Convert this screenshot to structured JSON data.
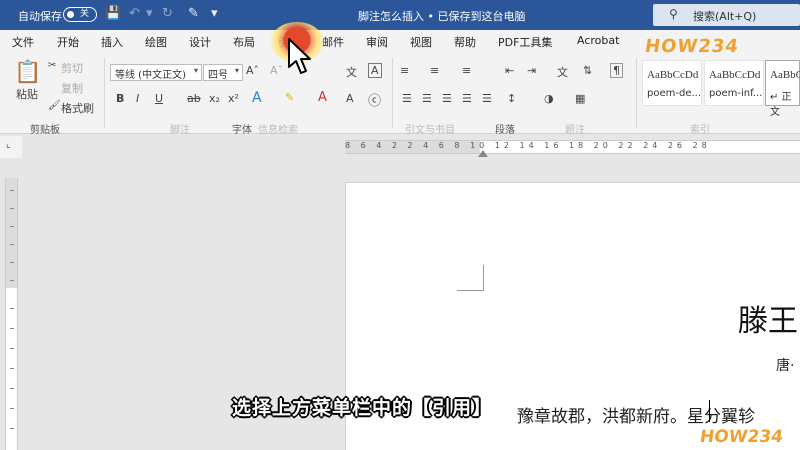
{
  "titlebar": {
    "autosave_label": "自动保存",
    "autosave_state": "关",
    "document_title": "脚注怎么插入 • 已保存到这台电脑",
    "search_placeholder": "搜索(Alt+Q)"
  },
  "tabs": [
    {
      "label": "文件"
    },
    {
      "label": "开始"
    },
    {
      "label": "插入"
    },
    {
      "label": "绘图"
    },
    {
      "label": "设计"
    },
    {
      "label": "布局"
    },
    {
      "label": "引用"
    },
    {
      "label": "邮件"
    },
    {
      "label": "审阅"
    },
    {
      "label": "视图"
    },
    {
      "label": "帮助"
    },
    {
      "label": "PDF工具集"
    },
    {
      "label": "Acrobat"
    }
  ],
  "active_tab": "引用",
  "ribbon": {
    "clipboard": {
      "paste": "粘贴",
      "cut": "剪切",
      "copy": "复制",
      "format_painter": "格式刷",
      "group": "剪贴板"
    },
    "font": {
      "font_name": "等线 (中文正文)",
      "font_size": "四号",
      "group": "字体"
    },
    "paragraph": {
      "group": "段落"
    },
    "styles": [
      {
        "sample": "AaBbCcDd",
        "name": "poem-de..."
      },
      {
        "sample": "AaBbCcDd",
        "name": "poem-inf..."
      },
      {
        "sample": "AaBbC",
        "name": "↵ 正文"
      }
    ],
    "faint_labels": [
      "脚注",
      "信息检索",
      "引文与书目",
      "题注",
      "索引"
    ]
  },
  "ruler": {
    "numbers": "8 6 4 2    2 4 6 8 10 12 14 16 18 20 22 24 26 28"
  },
  "document": {
    "heading": "滕王",
    "author": "唐·",
    "body": "豫章故郡，洪都新府。星分翼轸"
  },
  "caption": "选择上方菜单栏中的【引用】",
  "watermark": "HOW234",
  "colors": {
    "titlebar": "#2b579a",
    "tabbar": "#f3f3f3",
    "accent": "#2b579a",
    "highlight": "#e34a2c"
  }
}
